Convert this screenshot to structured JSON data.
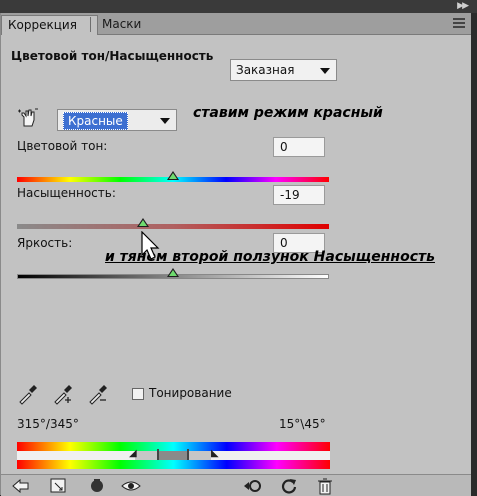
{
  "tabs": [
    {
      "label": "Коррекция",
      "active": true
    },
    {
      "label": "Маски",
      "active": false
    }
  ],
  "adjustment": {
    "title": "Цветовой тон/Насыщенность",
    "preset_value": "Заказная",
    "channel_value": "Красные"
  },
  "sliders": {
    "hue": {
      "label": "Цветовой тон:",
      "value": "0",
      "position": 0.5
    },
    "saturation": {
      "label": "Насыщенность:",
      "value": "-19",
      "position": 0.405
    },
    "lightness": {
      "label": "Яркость:",
      "value": "0",
      "position": 0.5
    }
  },
  "annotations": {
    "first": "ставим режим красный",
    "second": "и тянем второй ползунок Насыщенность"
  },
  "colorize": {
    "label": "Тонирование",
    "checked": false
  },
  "range": {
    "left": "315°/345°",
    "right": "15°\\45°"
  },
  "icons": {
    "tab_menu": "panel-menu-icon",
    "collapse": "collapse-arrows-icon",
    "hand": "targeted-adjustment-hand-icon",
    "eyedropper": "eyedropper-icon",
    "eyedropper_add": "eyedropper-add-icon",
    "eyedropper_sub": "eyedropper-subtract-icon",
    "back": "back-arrow-icon",
    "expand_view": "expand-view-icon",
    "clip": "clip-to-layer-icon",
    "visibility": "eye-icon",
    "previous_state": "view-previous-state-icon",
    "reset": "reset-icon",
    "trash": "trash-icon"
  },
  "colors": {
    "selection_blue": "#3c6fd1",
    "panel_bg": "#c2c2c2"
  }
}
